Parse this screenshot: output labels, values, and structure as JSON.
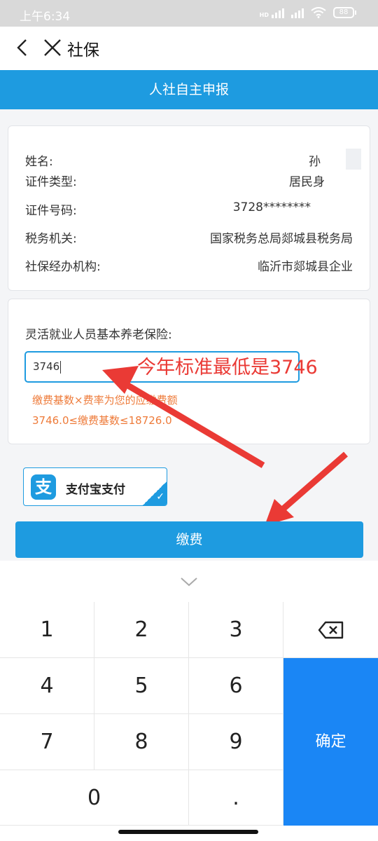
{
  "status_bar": {
    "time": "上午6:34",
    "hd_label": "HD",
    "battery": "88"
  },
  "nav": {
    "title": "社保",
    "back_icon": "chevron-left-icon",
    "close_icon": "close-icon"
  },
  "banner": {
    "title": "人社自主申报"
  },
  "info": {
    "rows": [
      {
        "label": "姓名:",
        "value": "孙"
      },
      {
        "label": "证件类型:",
        "value": "居民身"
      },
      {
        "label": "证件号码:",
        "value": "3728********"
      },
      {
        "label": "税务机关:",
        "value": "国家税务总局郯城县税务局"
      },
      {
        "label": "社保经办机构:",
        "value": "临沂市郯城县企业"
      }
    ]
  },
  "payment": {
    "label": "灵活就业人员基本养老保险:",
    "input_value": "3746",
    "hint_line1": "缴费基数×费率为您的应缴费额",
    "hint_line2": "3746.0≤缴费基数≤18726.0"
  },
  "annotation": {
    "text": "今年标准最低是3746",
    "color": "#ea3a35"
  },
  "pay_method": {
    "label": "支付宝支付",
    "logo_glyph": "支",
    "selected": true
  },
  "pay_button": {
    "label": "缴费"
  },
  "keyboard": {
    "keys": [
      "1",
      "2",
      "3",
      "4",
      "5",
      "6",
      "7",
      "8",
      "9",
      "0",
      "."
    ],
    "confirm_label": "确定",
    "backspace_icon": "backspace-icon",
    "toggle_icon": "chevron-down-icon"
  },
  "colors": {
    "primary": "#1e9be0",
    "confirm_key": "#1a86f5",
    "hint": "#ee7b3a",
    "annotation": "#ea3a35"
  }
}
